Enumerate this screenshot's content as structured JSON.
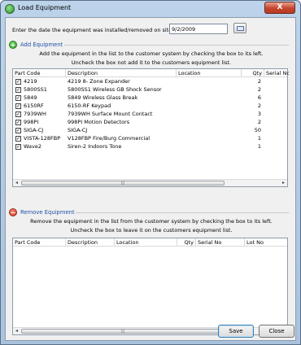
{
  "window": {
    "title": "Load Equipment",
    "close_label": "X"
  },
  "date": {
    "label": "Enter the date the equipment was installed/removed on site.",
    "value": "9/2/2009"
  },
  "add_section": {
    "title": "Add Equipment",
    "desc_line1": "Add the equipment in the list to the customer system by checking the box to its left.",
    "desc_line2": "Uncheck the box not add it to the customers equipment list.",
    "columns": [
      "Part Code",
      "Description",
      "Location",
      "Qty",
      "Serial No"
    ],
    "rows": [
      {
        "part": "4219",
        "desc": "4219 8- Zone Expander",
        "location": "",
        "qty": "2",
        "checked": true
      },
      {
        "part": "5800SS1",
        "desc": "5800SS1 Wireless GB Shock Sensor",
        "location": "",
        "qty": "2",
        "checked": true
      },
      {
        "part": "5849",
        "desc": "5849 Wireless Glass Break",
        "location": "",
        "qty": "6",
        "checked": true
      },
      {
        "part": "6150RF",
        "desc": "6150-RF Keypad",
        "location": "",
        "qty": "2",
        "checked": true
      },
      {
        "part": "7939WH",
        "desc": "7939WH Surface Mount Contact",
        "location": "",
        "qty": "3",
        "checked": true
      },
      {
        "part": "998PI",
        "desc": "998PI Motion Detectors",
        "location": "",
        "qty": "2",
        "checked": true
      },
      {
        "part": "SIGA-CJ",
        "desc": "SIGA-CJ",
        "location": "",
        "qty": "50",
        "checked": true
      },
      {
        "part": "VISTA-128FBP",
        "desc": "V128FBP Fire/Burg Commercial",
        "location": "",
        "qty": "1",
        "checked": true
      },
      {
        "part": "Wave2",
        "desc": "Siren-2 Indoors Tone",
        "location": "",
        "qty": "1",
        "checked": true
      }
    ]
  },
  "remove_section": {
    "title": "Remove Equipment",
    "desc_line1": "Remove the equipment in the list from the customer system by checking the box to its left.",
    "desc_line2": "Uncheck the box to leave it on the customers equipment list.",
    "columns": [
      "Part Code",
      "Description",
      "Location",
      "Qty",
      "Serial No",
      "Lot No"
    ]
  },
  "buttons": {
    "save": "Save",
    "close": "Close"
  },
  "icons": {
    "add": "add-circle-icon",
    "remove": "remove-circle-icon",
    "calendar": "calendar-icon"
  }
}
